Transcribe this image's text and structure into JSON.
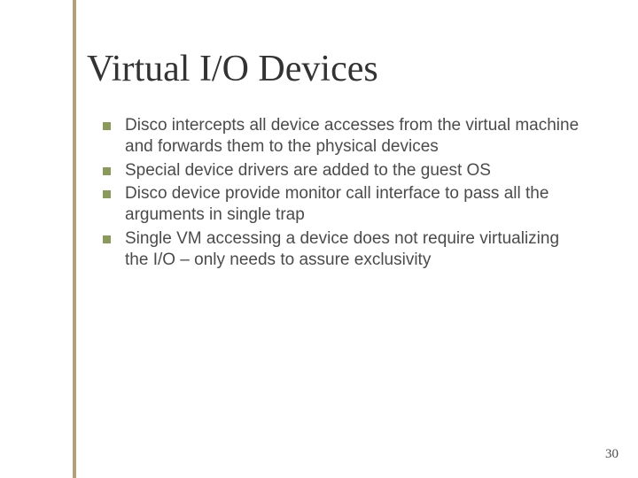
{
  "title": "Virtual I/O Devices",
  "bullets": [
    "Disco intercepts all device accesses from the virtual machine and forwards them to the physical devices",
    "Special device drivers are added to the guest OS",
    "Disco device provide monitor call interface to pass all the arguments in single trap",
    "Single VM accessing a device does not require virtualizing the I/O – only needs to assure exclusivity"
  ],
  "page_number": "30"
}
